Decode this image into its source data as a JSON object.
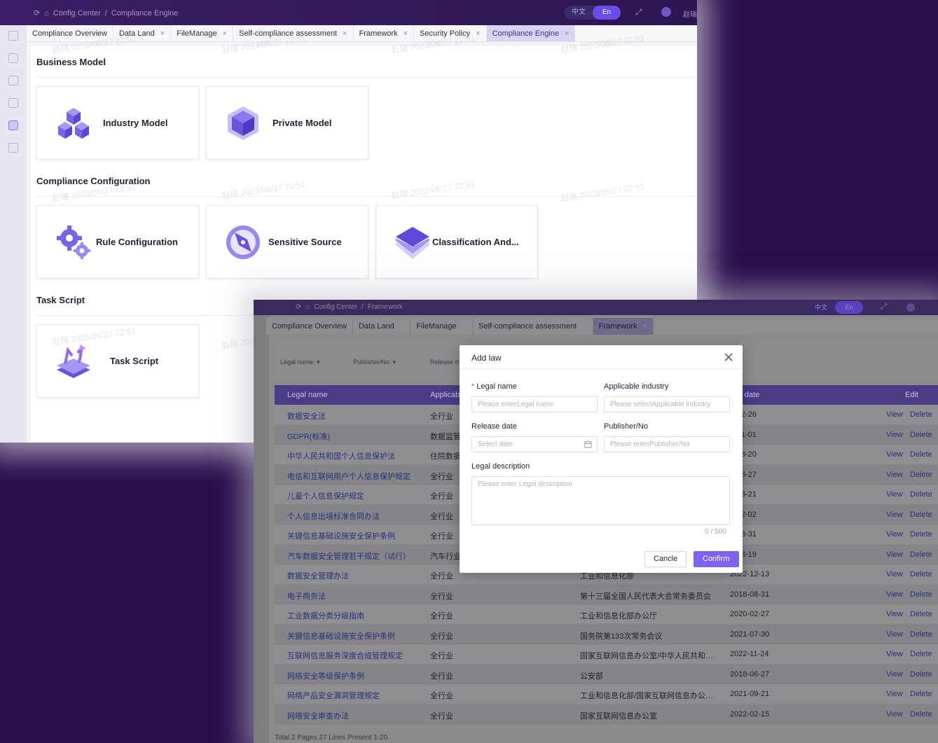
{
  "back_window": {
    "breadcrumb": [
      "Config Center",
      "/",
      "Compliance Engine"
    ],
    "lang": {
      "zh": "中文",
      "en": "En"
    },
    "user": "赵瑞",
    "tabs": [
      {
        "label": "Compliance Overview"
      },
      {
        "label": "Data Land"
      },
      {
        "label": "FileManage"
      },
      {
        "label": "Self-compliance assessment"
      },
      {
        "label": "Framework"
      },
      {
        "label": "Security Policy"
      },
      {
        "label": "Compliance Engine"
      }
    ],
    "sections": {
      "business_model": "Business Model",
      "compliance_configuration": "Compliance Configuration",
      "task_script": "Task Script"
    },
    "cards": {
      "industry_model": "Industry Model",
      "private_model": "Private Model",
      "rule_configuration": "Rule Configuration",
      "sensitive_source": "Sensitive Source",
      "classification": "Classification And...",
      "task_script": "Task Script"
    },
    "watermark": "赵瑞 2023/06/27 22:51"
  },
  "front_window": {
    "breadcrumb": [
      "Config Center",
      "/",
      "Framework"
    ],
    "lang": {
      "zh": "中文",
      "en": "En"
    },
    "tabs": [
      {
        "label": "Compliance Overview"
      },
      {
        "label": "Data Land"
      },
      {
        "label": "FileManage"
      },
      {
        "label": "Self-compliance assessment"
      },
      {
        "label": "Framework"
      }
    ],
    "filters": {
      "legal_name": "Legal name:",
      "publisher": "Publisher/No:",
      "release": "Release d"
    },
    "table": {
      "headers": {
        "legal_name": "Legal name",
        "industry": "Applicab",
        "release": "ase date",
        "edit": "Edit"
      },
      "view": "View",
      "delete": "Delete",
      "rows": [
        {
          "name": "数据安全法",
          "industry": "全行业",
          "publisher": "",
          "date": "1-02-26"
        },
        {
          "name": "GDPR(标准)",
          "industry": "数据监管",
          "publisher": "",
          "date": "1-01-01"
        },
        {
          "name": "中华人民共和国个人信息保护法",
          "industry": "住院数据",
          "publisher": "",
          "date": "1-08-20"
        },
        {
          "name": "电信和互联网用户个人信息保护规定",
          "industry": "全行业",
          "publisher": "",
          "date": "3-06-27"
        },
        {
          "name": "儿童个人信息保护规定",
          "industry": "全行业",
          "publisher": "",
          "date": "9-08-21"
        },
        {
          "name": "个人信息出境标准合同办法",
          "industry": "全行业",
          "publisher": "",
          "date": "3-02-02"
        },
        {
          "name": "关键信息基础设施安全保护条例",
          "industry": "全行业",
          "publisher": "",
          "date": "1-08-31"
        },
        {
          "name": "汽车数据安全管理若干规定（试行）",
          "industry": "汽车行业",
          "publisher": "",
          "date": "1-08-19"
        },
        {
          "name": "数据安全管理办法",
          "industry": "全行业",
          "publisher": "工业和信息化部",
          "date": "2022-12-13"
        },
        {
          "name": "电子商务法",
          "industry": "全行业",
          "publisher": "第十三届全国人民代表大会常务委员会",
          "date": "2018-08-31"
        },
        {
          "name": "工业数据分类分级指南",
          "industry": "全行业",
          "publisher": "工业和信息化部办公厅",
          "date": "2020-02-27"
        },
        {
          "name": "关键信息基础设施安全保护条例",
          "industry": "全行业",
          "publisher": "国务院第133次常务会议",
          "date": "2021-07-30"
        },
        {
          "name": "互联网信息服务深度合成管理规定",
          "industry": "全行业",
          "publisher": "国家互联网信息办公室/中华人民共和国工...",
          "date": "2022-11-24"
        },
        {
          "name": "网络安全等级保护条例",
          "industry": "全行业",
          "publisher": "公安部",
          "date": "2018-06-27"
        },
        {
          "name": "网络产品安全漏洞管理规定",
          "industry": "全行业",
          "publisher": "工业和信息化部/国家互联网信息办公室/...",
          "date": "2021-09-21"
        },
        {
          "name": "网络安全审查办法",
          "industry": "全行业",
          "publisher": "国家互联网信息办公室",
          "date": "2022-02-15"
        }
      ]
    },
    "footer": "Total 2 Pages  27 Lines  Present 1-20",
    "watermark": "赵瑞 2023/06/27 22:54"
  },
  "modal": {
    "title": "Add law",
    "fields": {
      "legal_name": {
        "label": "Legal name",
        "placeholder": "Please enterLegal name"
      },
      "industry": {
        "label": "Applicable industry",
        "placeholder": "Please selectApplicable industry"
      },
      "release_date": {
        "label": "Release date",
        "placeholder": "Select date"
      },
      "publisher": {
        "label": "Publisher/No",
        "placeholder": "Please enterPublisher/No"
      },
      "description": {
        "label": "Legal description",
        "placeholder": "Please enter Legal description"
      }
    },
    "counter": "0 / 500",
    "cancel": "Cancle",
    "confirm": "Confirm"
  },
  "colors": {
    "accent": "#7e62f0",
    "header_purple": "#4a3b84",
    "background": "#2a0f4d"
  }
}
